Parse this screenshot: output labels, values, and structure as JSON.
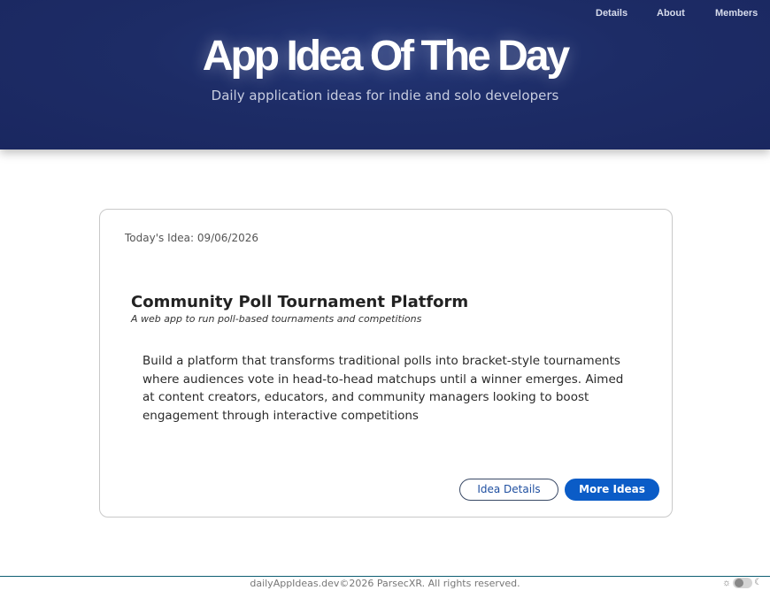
{
  "nav": {
    "items": [
      "Details",
      "About",
      "Members"
    ]
  },
  "header": {
    "title": "App Idea Of The Day",
    "subtitle": "Daily application ideas for indie and solo developers"
  },
  "card": {
    "date_line": "Today's Idea: 09/06/2026",
    "title": "Community Poll Tournament Platform",
    "tagline": "A web app to run poll-based tournaments and competitions",
    "description": "Build a platform that transforms traditional polls into bracket-style tournaments where audiences vote in head-to-head matchups until a winner emerges. Aimed at content creators, educators, and community managers looking to boost engagement through interactive competitions",
    "buttons": {
      "details": "Idea Details",
      "more": "More Ideas"
    }
  },
  "footer": {
    "text": "dailyAppIdeas.dev©2026 ParsecXR. All rights reserved.",
    "theme_icons": {
      "light": "sun-icon",
      "dark": "moon-icon"
    }
  },
  "colors": {
    "header_bg": "#1d2c66",
    "primary_button": "#0b5cc7",
    "footer_line": "#0f5f73"
  }
}
